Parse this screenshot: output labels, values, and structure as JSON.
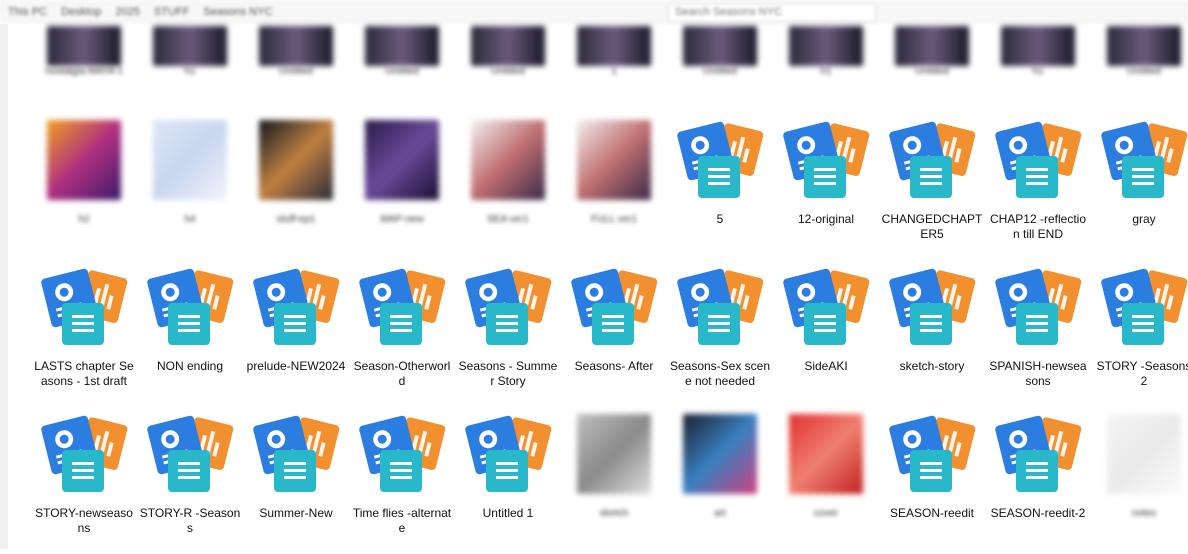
{
  "breadcrumb": [
    "This PC",
    "Desktop",
    "2025",
    "STUFF",
    "Seasons NYC"
  ],
  "search": {
    "placeholder": "Search Seasons NYC"
  },
  "colors": {
    "blue": "#2b7de0",
    "orange": "#f28f2f",
    "teal": "#29b8c9"
  },
  "row1": [
    {
      "label": "nostalgia-MAYA 1"
    },
    {
      "label": "h1"
    },
    {
      "label": "Untitled"
    },
    {
      "label": "Untitled"
    },
    {
      "label": "Untitled"
    },
    {
      "label": "1"
    },
    {
      "label": "Untitled"
    },
    {
      "label": "h1"
    },
    {
      "label": "Untitled"
    },
    {
      "label": "h1"
    },
    {
      "label": "Untitled"
    }
  ],
  "row2": [
    {
      "kind": "image",
      "label": "h2",
      "colors": [
        "#f0a020",
        "#b03080",
        "#3a1a6a"
      ]
    },
    {
      "kind": "image",
      "label": "h4",
      "colors": [
        "#dde6f5",
        "#c8d6ef",
        "#f2f5fb"
      ]
    },
    {
      "kind": "image",
      "label": "stuff-ep1",
      "colors": [
        "#101820",
        "#c08040",
        "#2a2a3a"
      ]
    },
    {
      "kind": "image",
      "label": "MAP-new",
      "colors": [
        "#2a1a4a",
        "#6a4a9a",
        "#1a1030"
      ]
    },
    {
      "kind": "image",
      "label": "SEA ver1",
      "colors": [
        "#f3f0f0",
        "#c07070",
        "#3a2a4a"
      ]
    },
    {
      "kind": "image",
      "label": "FULL ver1",
      "colors": [
        "#f3f0f0",
        "#c07070",
        "#3a2a4a"
      ]
    },
    {
      "kind": "doc",
      "label": "5"
    },
    {
      "kind": "doc",
      "label": "12-original"
    },
    {
      "kind": "doc",
      "label": "CHANGEDCHAPTER5"
    },
    {
      "kind": "doc",
      "label": "CHAP12 -reflection till END"
    },
    {
      "kind": "doc",
      "label": "gray"
    }
  ],
  "row3": [
    {
      "kind": "doc",
      "label": "LASTS chapter Seasons - 1st draft"
    },
    {
      "kind": "doc",
      "label": "NON ending"
    },
    {
      "kind": "doc",
      "label": "prelude-NEW2024"
    },
    {
      "kind": "doc",
      "label": "Season-Otherworld"
    },
    {
      "kind": "doc",
      "label": "Seasons - Summer Story"
    },
    {
      "kind": "doc",
      "label": "Seasons- After"
    },
    {
      "kind": "doc",
      "label": "Seasons-Sex scene not needed"
    },
    {
      "kind": "doc",
      "label": "SideAKI"
    },
    {
      "kind": "doc",
      "label": "sketch-story"
    },
    {
      "kind": "doc",
      "label": "SPANISH-newseasons"
    },
    {
      "kind": "doc",
      "label": "STORY -Seasons 2"
    }
  ],
  "row4": [
    {
      "kind": "doc",
      "label": "STORY-newseasons"
    },
    {
      "kind": "doc",
      "label": "STORY-R -Seasons"
    },
    {
      "kind": "doc",
      "label": "Summer-New"
    },
    {
      "kind": "doc",
      "label": "Time flies -alternate"
    },
    {
      "kind": "doc",
      "label": "Untitled 1"
    },
    {
      "kind": "image",
      "label": "sketch",
      "colors": [
        "#bfbfbf",
        "#8a8a8a",
        "#e0e0e0"
      ]
    },
    {
      "kind": "image",
      "label": "art",
      "colors": [
        "#1a2030",
        "#3a80c0",
        "#d04080"
      ]
    },
    {
      "kind": "image",
      "label": "cover",
      "colors": [
        "#e03030",
        "#f08070",
        "#c02020"
      ]
    },
    {
      "kind": "doc",
      "label": "SEASON-reedit"
    },
    {
      "kind": "doc",
      "label": "SEASON-reedit-2"
    },
    {
      "kind": "image",
      "label": "notes",
      "colors": [
        "#f4f4f4",
        "#eaeaea",
        "#fafafa"
      ]
    }
  ]
}
